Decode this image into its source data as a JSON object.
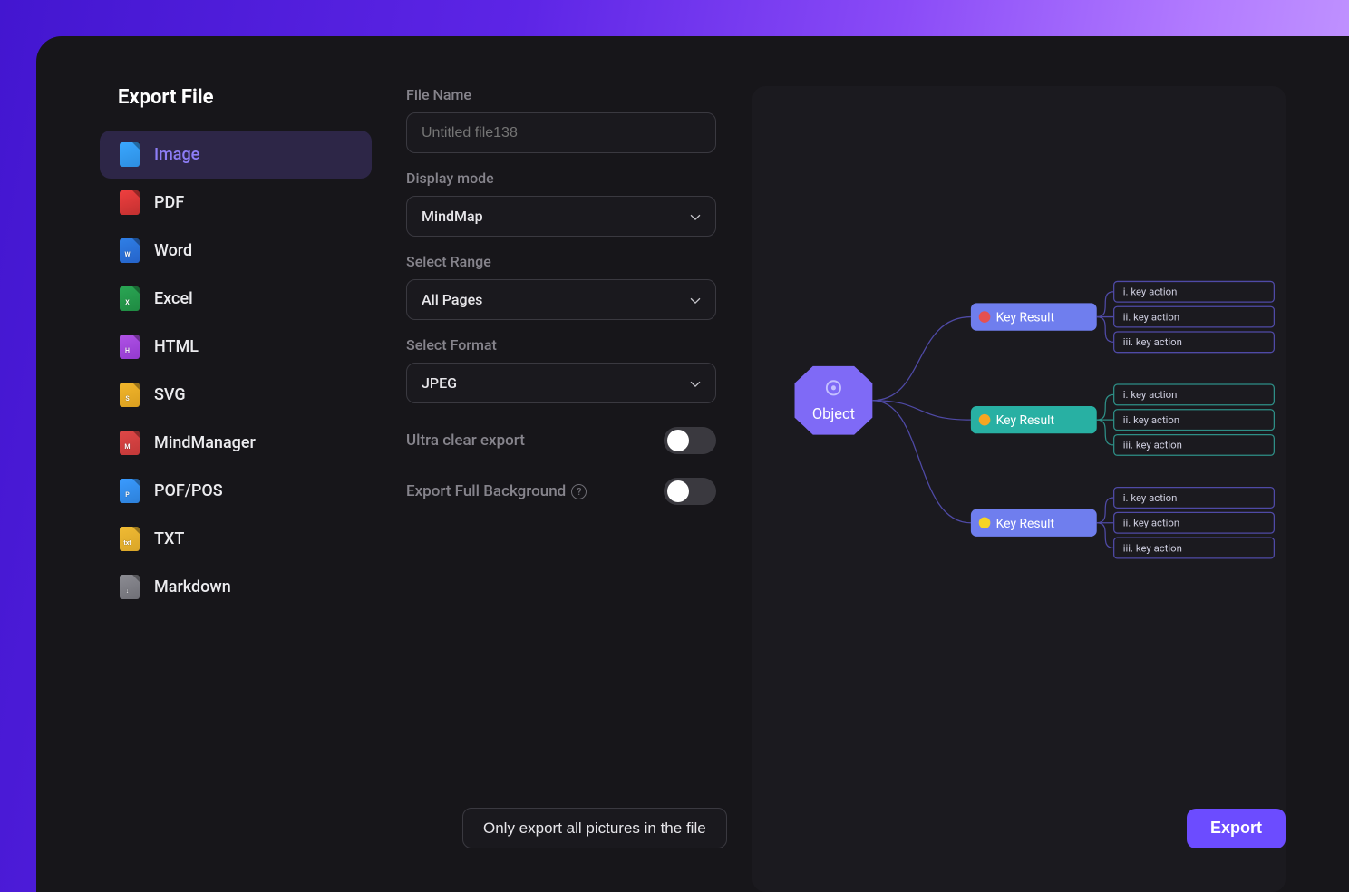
{
  "title": "Export File",
  "sidebar": [
    {
      "label": "Image",
      "color1": "#3aa8ff",
      "color2": "#2d8de0",
      "tag": ""
    },
    {
      "label": "PDF",
      "color1": "#ef3f3f",
      "color2": "#c23030",
      "tag": ""
    },
    {
      "label": "Word",
      "color1": "#2f7fe6",
      "color2": "#2563c9",
      "tag": "W"
    },
    {
      "label": "Excel",
      "color1": "#2aa654",
      "color2": "#1f8a42",
      "tag": "X"
    },
    {
      "label": "HTML",
      "color1": "#b053e6",
      "color2": "#9339cf",
      "tag": "H"
    },
    {
      "label": "SVG",
      "color1": "#f3b72c",
      "color2": "#d99e1f",
      "tag": "S"
    },
    {
      "label": "MindManager",
      "color1": "#e04848",
      "color2": "#c23838",
      "tag": "M"
    },
    {
      "label": "POF/POS",
      "color1": "#3a9bff",
      "color2": "#2d80d9",
      "tag": "P"
    },
    {
      "label": "TXT",
      "color1": "#f0bb34",
      "color2": "#d9a528",
      "tag": "txt"
    },
    {
      "label": "Markdown",
      "color1": "#8c8c93",
      "color2": "#6f6f76",
      "tag": "↓"
    }
  ],
  "sidebarActive": 0,
  "form": {
    "fileNameLabel": "File Name",
    "fileNamePlaceholder": "Untitled file138",
    "displayModeLabel": "Display mode",
    "displayModeValue": "MindMap",
    "selectRangeLabel": "Select Range",
    "selectRangeValue": "All Pages",
    "selectFormatLabel": "Select Format",
    "selectFormatValue": "JPEG",
    "ultraClearLabel": "Ultra clear export",
    "ultraClearValue": false,
    "exportBgLabel": "Export Full Background",
    "exportBgValue": false
  },
  "preview": {
    "root": "Object",
    "tier2Label": "Key Result",
    "tier3Labels": [
      "i. key action",
      "ii. key action",
      "iii. key action"
    ],
    "colors": {
      "root": "#7f6af6",
      "kr1": "#6f7eee",
      "kr2": "#28b0a3",
      "kr3": "#6f7eee"
    }
  },
  "footer": {
    "onlyPictures": "Only export all pictures in the file",
    "export": "Export"
  }
}
